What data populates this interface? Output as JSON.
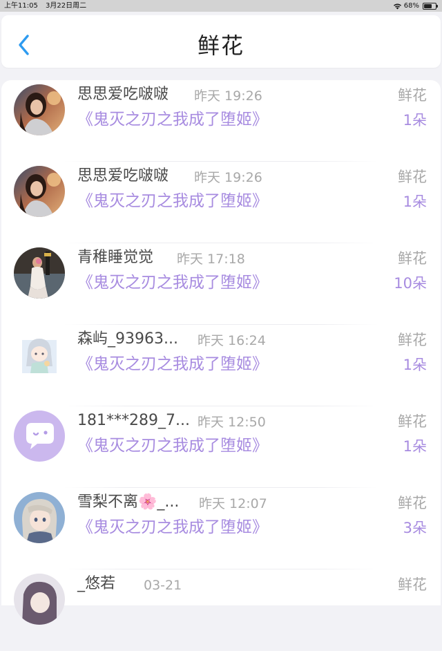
{
  "status_bar": {
    "time": "上午11:05",
    "date": "3月22日周二",
    "battery": "68%",
    "battery_level": 0.68
  },
  "header": {
    "title": "鲜花"
  },
  "colors": {
    "accent": "#2d9bf0",
    "purple": "#a78be0",
    "muted": "#a8a8a8"
  },
  "items": [
    {
      "name": "思思爱吃啵啵",
      "time": "昨天 19:26",
      "book": "《鬼灭之刃之我成了堕姬》",
      "gift": "鲜花",
      "count": "1朵",
      "avatar": "portrait-photo"
    },
    {
      "name": "思思爱吃啵啵",
      "time": "昨天 19:26",
      "book": "《鬼灭之刃之我成了堕姬》",
      "gift": "鲜花",
      "count": "1朵",
      "avatar": "portrait-photo"
    },
    {
      "name": "青稚睡觉觉",
      "time": "昨天 17:18",
      "book": "《鬼灭之刃之我成了堕姬》",
      "gift": "鲜花",
      "count": "10朵",
      "avatar": "figure-photo"
    },
    {
      "name": "森屿_93963...",
      "time": "昨天 16:24",
      "book": "《鬼灭之刃之我成了堕姬》",
      "gift": "鲜花",
      "count": "1朵",
      "avatar": "chibi-illustration"
    },
    {
      "name": "181***289_7...",
      "time": "昨天 12:50",
      "book": "《鬼灭之刃之我成了堕姬》",
      "gift": "鲜花",
      "count": "1朵",
      "avatar": "default-chat-avatar"
    },
    {
      "name": "雪梨不离🌸_...",
      "time": "昨天 12:07",
      "book": "《鬼灭之刃之我成了堕姬》",
      "gift": "鲜花",
      "count": "3朵",
      "avatar": "anime-girl"
    },
    {
      "name": "_悠若",
      "time": "03-21",
      "book": "",
      "gift": "鲜花",
      "count": "",
      "avatar": "anime-partial"
    }
  ]
}
